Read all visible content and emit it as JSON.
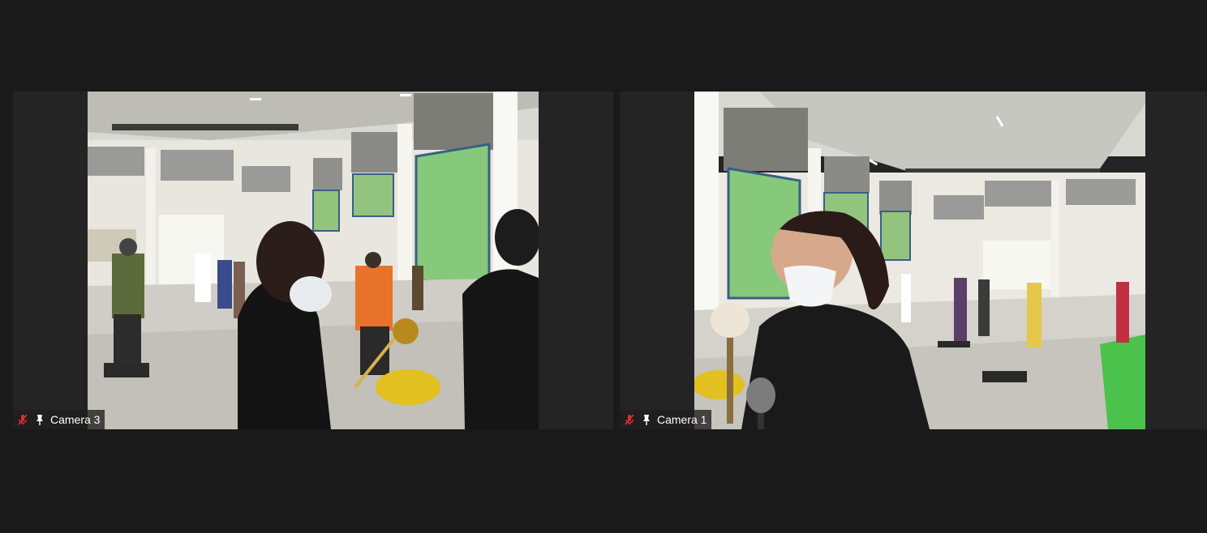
{
  "participants": [
    {
      "name": "Camera 3",
      "mic_icon": "mic-muted-icon",
      "pin_icon": "pin-icon",
      "mic_color": "#e02f2f"
    },
    {
      "name": "Camera 1",
      "mic_icon": "mic-muted-icon",
      "pin_icon": "pin-icon",
      "mic_color": "#e02f2f"
    }
  ],
  "colors": {
    "background": "#1a1a1a",
    "tile_background": "#242424",
    "label_text": "#ffffff"
  }
}
